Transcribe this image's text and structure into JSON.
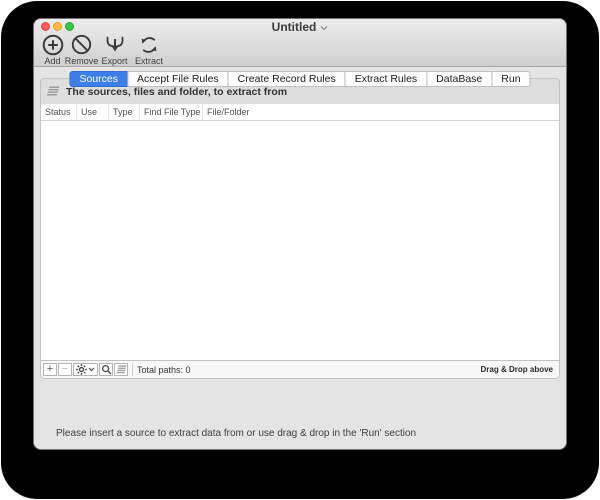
{
  "window": {
    "title": "Untitled"
  },
  "toolbar": {
    "items": [
      {
        "label": "Add",
        "icon": "add-circle-icon"
      },
      {
        "label": "Remove",
        "icon": "remove-prohibit-icon"
      },
      {
        "label": "Export",
        "icon": "export-merge-arrow-icon"
      },
      {
        "label": "Extract",
        "icon": "extract-cycle-icon"
      }
    ]
  },
  "tabs": [
    {
      "label": "Sources",
      "selected": true
    },
    {
      "label": "Accept File Rules",
      "selected": false
    },
    {
      "label": "Create Record Rules",
      "selected": false
    },
    {
      "label": "Extract Rules",
      "selected": false
    },
    {
      "label": "DataBase",
      "selected": false
    },
    {
      "label": "Run",
      "selected": false
    }
  ],
  "sources_panel": {
    "header_text": "The sources, files and folder, to extract from",
    "header_icon": "list-icon",
    "table": {
      "columns": [
        "Status",
        "Use",
        "Type",
        "Find File Type",
        "File/Folder"
      ],
      "rows": []
    },
    "footer": {
      "add_symbol": "+",
      "remove_symbol": "−",
      "button_icons": [
        "gear-icon",
        "search-icon",
        "list-icon"
      ],
      "total_paths_label": "Total paths: 0",
      "drag_hint": "Drag & Drop above"
    }
  },
  "status_message": "Please insert a source to extract data from or use drag & drop in the 'Run' section",
  "colors": {
    "accent_blue": "#3d7ee9",
    "traffic_red": "#fc5b57",
    "traffic_yellow": "#fdbc40",
    "traffic_green": "#33c748"
  }
}
